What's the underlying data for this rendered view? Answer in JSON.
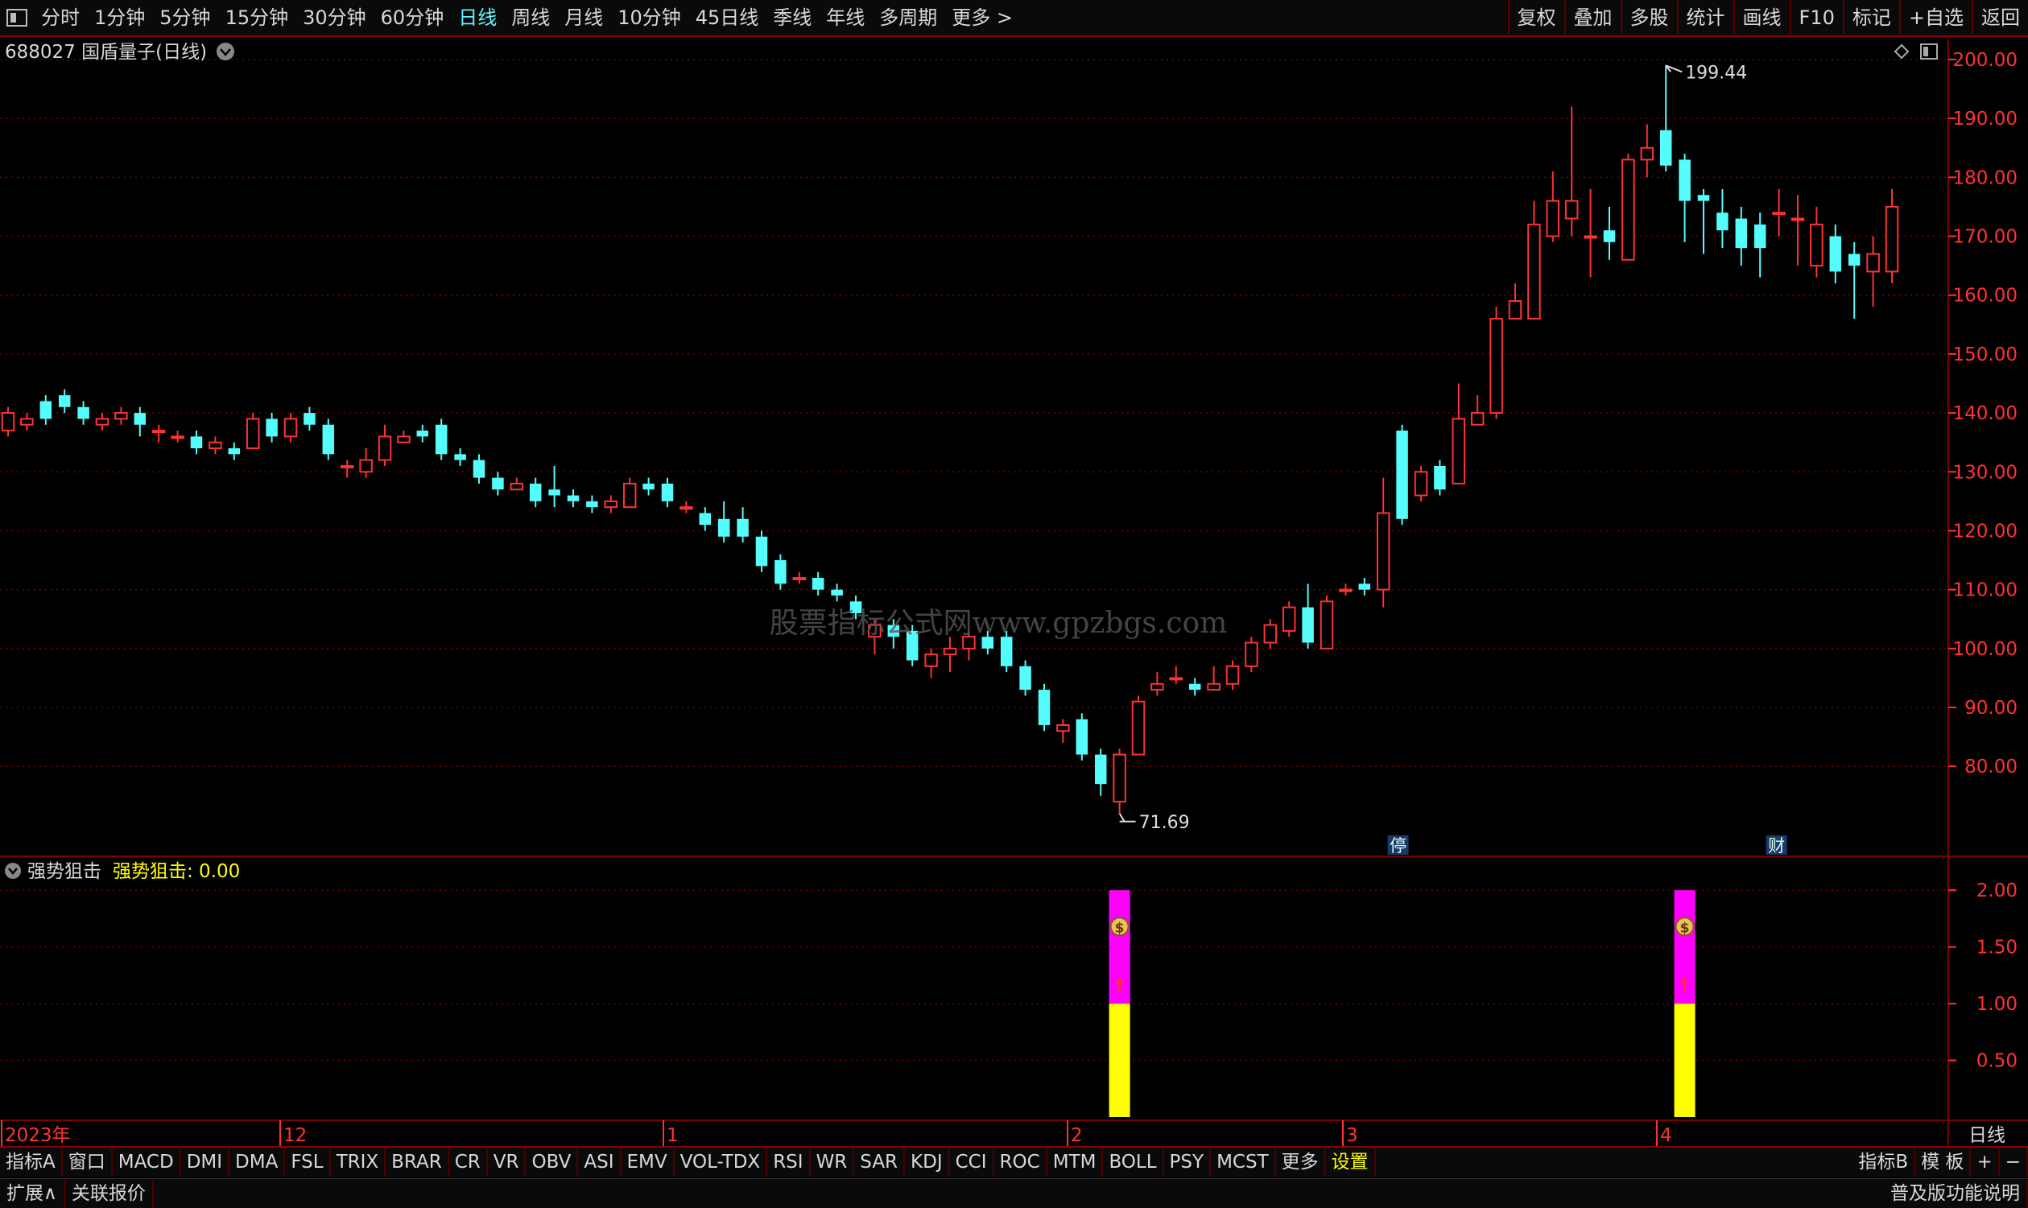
{
  "toolbar": {
    "periods": [
      "分时",
      "1分钟",
      "5分钟",
      "15分钟",
      "30分钟",
      "60分钟",
      "日线",
      "周线",
      "月线",
      "10分钟",
      "45日线",
      "季线",
      "年线",
      "多周期",
      "更多 >"
    ],
    "active_period": "日线",
    "right_buttons": [
      "复权",
      "叠加",
      "多股",
      "统计",
      "画线",
      "F10",
      "标记",
      "+自选",
      "返回"
    ]
  },
  "main_panel": {
    "title": "688027 国盾量子(日线)",
    "high_label": "199.44",
    "low_label": "71.69",
    "watermark": "股票指标公式网www.gpzbgs.com",
    "markers": [
      "停",
      "财"
    ]
  },
  "indicator_panel": {
    "name": "强势狙击",
    "value_label": "强势狙击: 0.00"
  },
  "x_axis": {
    "labels": [
      "2023年",
      "12",
      "1",
      "2",
      "3",
      "4"
    ],
    "period": "日线"
  },
  "indicator_tabs": [
    "指标A",
    "窗口",
    "MACD",
    "DMI",
    "DMA",
    "FSL",
    "TRIX",
    "BRAR",
    "CR",
    "VR",
    "OBV",
    "ASI",
    "EMV",
    "VOL-TDX",
    "RSI",
    "WR",
    "SAR",
    "KDJ",
    "CCI",
    "ROC",
    "MTM",
    "BOLL",
    "PSY",
    "MCST",
    "更多",
    "设置"
  ],
  "indicator_tabs_right": [
    "指标B",
    "模 板",
    "+",
    "−"
  ],
  "bottom_bar": {
    "left": [
      "扩展∧",
      "关联报价"
    ],
    "right": "普及版功能说明"
  },
  "colors": {
    "up": "#ff3232",
    "down": "#54fcfc",
    "grid": "#7a0000",
    "magenta": "#ff00ff",
    "yellow": "#ffff00"
  },
  "chart_data": {
    "type": "candlestick",
    "price_axis": {
      "ticks": [
        "200.00",
        "190.00",
        "180.00",
        "170.00",
        "160.00",
        "150.00",
        "140.00",
        "130.00",
        "120.00",
        "110.00",
        "100.00",
        "90.00",
        "80.00"
      ],
      "range": [
        65,
        203
      ]
    },
    "candles": [
      [
        137,
        140,
        141,
        136
      ],
      [
        138,
        139,
        140,
        137
      ],
      [
        142,
        139,
        143,
        138
      ],
      [
        143,
        141,
        144,
        140
      ],
      [
        141,
        139,
        142,
        138
      ],
      [
        138,
        139,
        140,
        137
      ],
      [
        139,
        140,
        141,
        138
      ],
      [
        140,
        138,
        141,
        136
      ],
      [
        137,
        137,
        138,
        135
      ],
      [
        136,
        136,
        137,
        135
      ],
      [
        136,
        134,
        137,
        133
      ],
      [
        134,
        135,
        136,
        133
      ],
      [
        134,
        133,
        135,
        132
      ],
      [
        134,
        139,
        140,
        134
      ],
      [
        139,
        136,
        140,
        135
      ],
      [
        136,
        139,
        140,
        135
      ],
      [
        140,
        138,
        141,
        137
      ],
      [
        138,
        133,
        139,
        132
      ],
      [
        131,
        131,
        132,
        129
      ],
      [
        130,
        132,
        134,
        129
      ],
      [
        132,
        136,
        138,
        131
      ],
      [
        135,
        136,
        137,
        135
      ],
      [
        137,
        136,
        138,
        135
      ],
      [
        138,
        133,
        139,
        132
      ],
      [
        133,
        132,
        134,
        131
      ],
      [
        132,
        129,
        133,
        128
      ],
      [
        129,
        127,
        130,
        126
      ],
      [
        127,
        128,
        129,
        127
      ],
      [
        128,
        125,
        129,
        124
      ],
      [
        127,
        126,
        131,
        124
      ],
      [
        126,
        125,
        127,
        124
      ],
      [
        125,
        124,
        126,
        123
      ],
      [
        124,
        125,
        126,
        123
      ],
      [
        124,
        128,
        129,
        124
      ],
      [
        128,
        127,
        129,
        126
      ],
      [
        128,
        125,
        129,
        124
      ],
      [
        124,
        124,
        125,
        123
      ],
      [
        123,
        121,
        124,
        120
      ],
      [
        122,
        119,
        125,
        118
      ],
      [
        122,
        119,
        124,
        118
      ],
      [
        119,
        114,
        120,
        113
      ],
      [
        115,
        111,
        116,
        110
      ],
      [
        112,
        112,
        113,
        111
      ],
      [
        112,
        110,
        113,
        109
      ],
      [
        110,
        109,
        111,
        108
      ],
      [
        108,
        106,
        109,
        105
      ],
      [
        102,
        104,
        105,
        99
      ],
      [
        104,
        102,
        105,
        100
      ],
      [
        103,
        98,
        104,
        97
      ],
      [
        97,
        99,
        100,
        95
      ],
      [
        99,
        100,
        102,
        96
      ],
      [
        100,
        102,
        103,
        98
      ],
      [
        102,
        100,
        103,
        99
      ],
      [
        102,
        97,
        103,
        96
      ],
      [
        97,
        93,
        98,
        92
      ],
      [
        93,
        87,
        94,
        86
      ],
      [
        86,
        87,
        88,
        84
      ],
      [
        88,
        82,
        89,
        81
      ],
      [
        82,
        77,
        83,
        75
      ],
      [
        74,
        82,
        83,
        72
      ],
      [
        82,
        91,
        92,
        82
      ],
      [
        93,
        94,
        96,
        92
      ],
      [
        95,
        95,
        97,
        94
      ],
      [
        94,
        93,
        95,
        92
      ],
      [
        93,
        94,
        97,
        93
      ],
      [
        94,
        97,
        98,
        93
      ],
      [
        97,
        101,
        102,
        96
      ],
      [
        101,
        104,
        105,
        100
      ],
      [
        103,
        107,
        108,
        102
      ],
      [
        107,
        101,
        111,
        100
      ],
      [
        100,
        108,
        109,
        100
      ],
      [
        110,
        110,
        111,
        109
      ],
      [
        111,
        110,
        112,
        109
      ],
      [
        110,
        123,
        129,
        107
      ],
      [
        137,
        122,
        138,
        121
      ],
      [
        126,
        130,
        131,
        125
      ],
      [
        131,
        127,
        132,
        126
      ],
      [
        128,
        139,
        145,
        128
      ],
      [
        138,
        140,
        143,
        138
      ],
      [
        140,
        156,
        158,
        139
      ],
      [
        156,
        159,
        162,
        156
      ],
      [
        156,
        172,
        176,
        156
      ],
      [
        170,
        176,
        181,
        169
      ],
      [
        173,
        176,
        192,
        170
      ],
      [
        170,
        170,
        178,
        163
      ],
      [
        171,
        169,
        175,
        166
      ],
      [
        166,
        183,
        184,
        166
      ],
      [
        183,
        185,
        189,
        180
      ],
      [
        188,
        182,
        199,
        181
      ],
      [
        183,
        176,
        184,
        169
      ],
      [
        177,
        176,
        178,
        167
      ],
      [
        174,
        171,
        178,
        168
      ],
      [
        173,
        168,
        175,
        165
      ],
      [
        172,
        168,
        174,
        163
      ],
      [
        174,
        174,
        178,
        170
      ],
      [
        173,
        173,
        177,
        165
      ],
      [
        165,
        172,
        175,
        163
      ],
      [
        170,
        164,
        172,
        162
      ],
      [
        167,
        165,
        169,
        156
      ],
      [
        164,
        167,
        170,
        158
      ],
      [
        164,
        175,
        178,
        162
      ]
    ],
    "indicator": {
      "range": [
        0,
        2.2
      ],
      "ticks": [
        "2.00",
        "1.50",
        "1.00",
        "0.50"
      ],
      "signals": [
        {
          "candle_index": 59,
          "yellow_bar": 1.0,
          "magenta_bar": 2.0,
          "icons": [
            "$",
            "↑"
          ]
        },
        {
          "candle_index": 89,
          "yellow_bar": 1.0,
          "magenta_bar": 2.0,
          "icons": [
            "$",
            "↑"
          ]
        }
      ]
    }
  }
}
